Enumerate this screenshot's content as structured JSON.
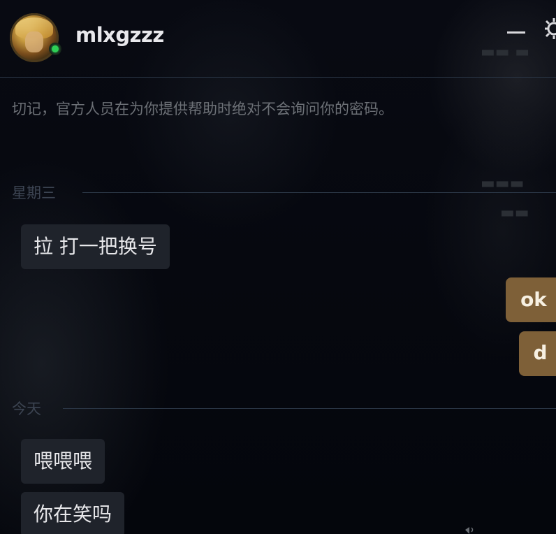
{
  "header": {
    "username": "mlxgzzz",
    "status": "online"
  },
  "notice": "切记，官方人员在为你提供帮助时绝对不会询问你的密码。",
  "sections": [
    {
      "date": "星期三",
      "incoming": [
        "拉 打一把换号"
      ],
      "outgoing": [
        "ok",
        "d"
      ]
    },
    {
      "date": "今天",
      "incoming": [
        "喂喂喂",
        "你在笑吗"
      ],
      "outgoing": []
    }
  ],
  "colors": {
    "background": "#05070d",
    "incoming_bubble": "#1f232b",
    "outgoing_bubble": "#7e6038",
    "online": "#2ecf56"
  },
  "icons": {
    "minimize": "minimize-icon",
    "settings": "gear-icon",
    "online": "online-status-icon"
  }
}
